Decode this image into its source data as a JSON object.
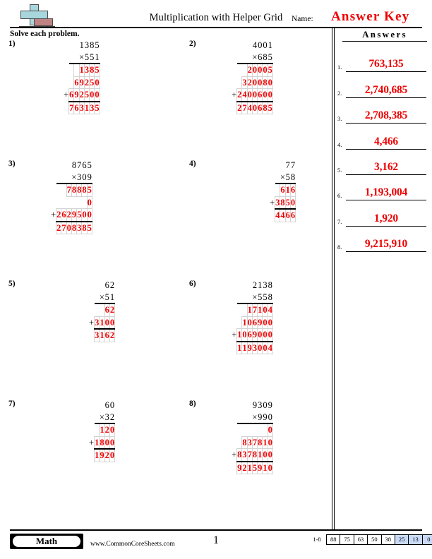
{
  "header": {
    "title": "Multiplication with Helper Grid",
    "name_label": "Name:",
    "answer_key": "Answer Key",
    "logo_icon": "plus-block-logo"
  },
  "subheader": {
    "instruction": "Solve each problem.",
    "answers_heading": "Answers"
  },
  "problems": [
    {
      "number": "1)",
      "multiplicand": [
        "1",
        "3",
        "8",
        "5"
      ],
      "multiplier": [
        "5",
        "5",
        "1"
      ],
      "times_symbol": "×",
      "plus_symbol": "+",
      "partials": [
        [
          "",
          "1",
          "3",
          "8",
          "5"
        ],
        [
          "6",
          "9",
          "2",
          "5",
          "0"
        ],
        [
          "6",
          "9",
          "2",
          "5",
          "0",
          "0"
        ]
      ],
      "total": [
        "7",
        "6",
        "3",
        "1",
        "3",
        "5"
      ]
    },
    {
      "number": "2)",
      "multiplicand": [
        "4",
        "0",
        "0",
        "1"
      ],
      "multiplier": [
        "6",
        "8",
        "5"
      ],
      "times_symbol": "×",
      "plus_symbol": "+",
      "partials": [
        [
          "2",
          "0",
          "0",
          "0",
          "5"
        ],
        [
          "3",
          "2",
          "0",
          "0",
          "8",
          "0"
        ],
        [
          "2",
          "4",
          "0",
          "0",
          "6",
          "0",
          "0"
        ]
      ],
      "total": [
        "2",
        "7",
        "4",
        "0",
        "6",
        "8",
        "5"
      ]
    },
    {
      "number": "3)",
      "multiplicand": [
        "8",
        "7",
        "6",
        "5"
      ],
      "multiplier": [
        "3",
        "0",
        "9"
      ],
      "times_symbol": "×",
      "plus_symbol": "+",
      "partials": [
        [
          "7",
          "8",
          "8",
          "8",
          "5"
        ],
        [
          "0"
        ],
        [
          "2",
          "6",
          "2",
          "9",
          "5",
          "0",
          "0"
        ]
      ],
      "total": [
        "2",
        "7",
        "0",
        "8",
        "3",
        "8",
        "5"
      ]
    },
    {
      "number": "4)",
      "multiplicand": [
        "7",
        "7"
      ],
      "multiplier": [
        "5",
        "8"
      ],
      "times_symbol": "×",
      "plus_symbol": "+",
      "partials": [
        [
          "6",
          "1",
          "6"
        ],
        [
          "3",
          "8",
          "5",
          "0"
        ]
      ],
      "total": [
        "4",
        "4",
        "6",
        "6"
      ]
    },
    {
      "number": "5)",
      "multiplicand": [
        "6",
        "2"
      ],
      "multiplier": [
        "5",
        "1"
      ],
      "times_symbol": "×",
      "plus_symbol": "+",
      "partials": [
        [
          "6",
          "2"
        ],
        [
          "3",
          "1",
          "0",
          "0"
        ]
      ],
      "total": [
        "3",
        "1",
        "6",
        "2"
      ]
    },
    {
      "number": "6)",
      "multiplicand": [
        "2",
        "1",
        "3",
        "8"
      ],
      "multiplier": [
        "5",
        "5",
        "8"
      ],
      "times_symbol": "×",
      "plus_symbol": "+",
      "partials": [
        [
          "1",
          "7",
          "1",
          "0",
          "4"
        ],
        [
          "1",
          "0",
          "6",
          "9",
          "0",
          "0"
        ],
        [
          "1",
          "0",
          "6",
          "9",
          "0",
          "0",
          "0"
        ]
      ],
      "total": [
        "1",
        "1",
        "9",
        "3",
        "0",
        "0",
        "4"
      ]
    },
    {
      "number": "7)",
      "multiplicand": [
        "6",
        "0"
      ],
      "multiplier": [
        "3",
        "2"
      ],
      "times_symbol": "×",
      "plus_symbol": "+",
      "partials": [
        [
          "1",
          "2",
          "0"
        ],
        [
          "1",
          "8",
          "0",
          "0"
        ]
      ],
      "total": [
        "1",
        "9",
        "2",
        "0"
      ]
    },
    {
      "number": "8)",
      "multiplicand": [
        "9",
        "3",
        "0",
        "9"
      ],
      "multiplier": [
        "9",
        "9",
        "0"
      ],
      "times_symbol": "×",
      "plus_symbol": "+",
      "partials": [
        [
          "0"
        ],
        [
          "8",
          "3",
          "7",
          "8",
          "1",
          "0"
        ],
        [
          "8",
          "3",
          "7",
          "8",
          "1",
          "0",
          "0"
        ]
      ],
      "total": [
        "9",
        "2",
        "1",
        "5",
        "9",
        "1",
        "0"
      ]
    }
  ],
  "answers": [
    {
      "index": "1.",
      "value": "763,135"
    },
    {
      "index": "2.",
      "value": "2,740,685"
    },
    {
      "index": "3.",
      "value": "2,708,385"
    },
    {
      "index": "4.",
      "value": "4,466"
    },
    {
      "index": "5.",
      "value": "3,162"
    },
    {
      "index": "6.",
      "value": "1,193,004"
    },
    {
      "index": "7.",
      "value": "1,920"
    },
    {
      "index": "8.",
      "value": "9,215,910"
    }
  ],
  "footer": {
    "subject_badge": "Math",
    "url": "www.CommonCoreSheets.com",
    "page_number": "1",
    "scale_range": "1-8",
    "scale_values": [
      "88",
      "75",
      "63",
      "50",
      "38",
      "25",
      "13",
      "0"
    ],
    "scale_highlighted": [
      false,
      false,
      false,
      false,
      false,
      true,
      true,
      true
    ]
  },
  "colors": {
    "answer_red": "#ee0000",
    "grid_border": "#d4d4d4",
    "highlight_blue": "#c9daf8",
    "logo_teal": "#a8d6dd",
    "logo_maroon": "#bf8383"
  }
}
